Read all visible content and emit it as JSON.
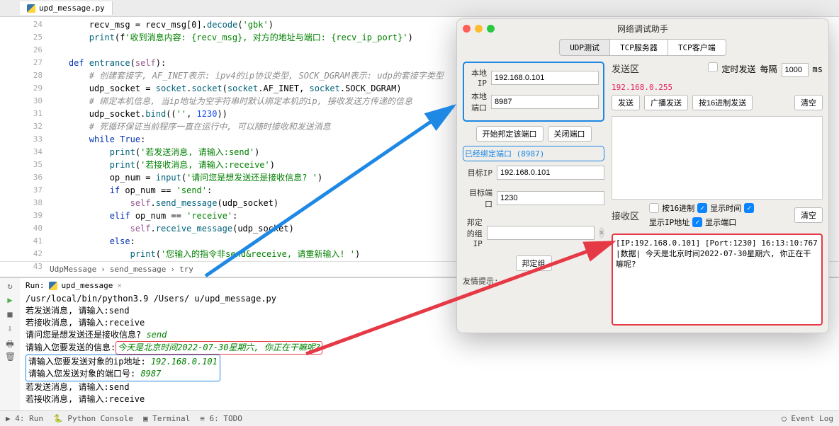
{
  "ide": {
    "file_tab": "upd_message.py",
    "line_start": 24,
    "code_lines": [
      "        recv_msg = recv_msg[0].decode('gbk')",
      "        print(f'收到消息内容: {recv_msg}, 对方的地址与端口: {recv_ip_port}')",
      "",
      "    def entrance(self):",
      "        # 创建套接字, AF_INET表示: ipv4的ip协议类型, SOCK_DGRAM表示: udp的套接字类型",
      "        udp_socket = socket.socket(socket.AF_INET, socket.SOCK_DGRAM)",
      "        # 绑定本机信息, 当ip地址为空字符串时默认绑定本机的ip, 接收发送方传递的信息",
      "        udp_socket.bind(('', 1230))",
      "        # 死循环保证当前程序一直在运行中, 可以随时接收和发送消息",
      "        while True:",
      "            print('若发送消息, 请输入:send')",
      "            print('若接收消息, 请输入:receive')",
      "            op_num = input('请问您是想发送还是接收信息? ')",
      "            if op_num == 'send':",
      "                self.send_message(udp_socket)",
      "            elif op_num == 'receive':",
      "                self.receive_message(udp_socket)",
      "            else:",
      "                print('您输入的指令非send&receive, 请重新输入! ')",
      ""
    ],
    "breadcrumb": [
      "UdpMessage",
      "send_message",
      "try"
    ],
    "run_label": "Run:",
    "run_tab": "upd_message",
    "console_lines": {
      "l0": "/usr/local/bin/python3.9 /Users/                                      u/upd_message.py",
      "l1": "若发送消息, 请输入:send",
      "l2": "若接收消息, 请输入:receive",
      "l3": "请问您是想发送还是接收信息? ",
      "l3v": "send",
      "l4": "请输入您要发送的信息:",
      "l4v": "今天是北京时间2022-07-30星期六, 你正在干嘛呢?",
      "l5": "请输入您要发送对象的ip地址: ",
      "l5v": "192.168.0.101",
      "l6": "请输入您发送对象的端口号: ",
      "l6v": "8987",
      "l7": "若发送消息, 请输入:send",
      "l8": "若接收消息, 请输入:receive"
    },
    "status": {
      "run": "4: Run",
      "console": "Python Console",
      "terminal": "Terminal",
      "todo": "6: TODO",
      "eventlog": "Event Log"
    }
  },
  "net": {
    "title": "网络调试助手",
    "tabs": [
      "UDP测试",
      "TCP服务器",
      "TCP客户端"
    ],
    "local_ip_lbl": "本地IP",
    "local_ip": "192.168.0.101",
    "local_port_lbl": "本地端口",
    "local_port": "8987",
    "btn_bind": "开始邦定该端口",
    "btn_close": "关闭端口",
    "bound_msg": "已经绑定端口 (8987)",
    "target_ip_lbl": "目标IP",
    "target_ip": "192.168.0.101",
    "target_port_lbl": "目标端口",
    "target_port": "1230",
    "group_ip_lbl": "邦定的组IP",
    "btn_group": "邦定组",
    "hint_lbl": "友情提示:",
    "send_title": "发送区",
    "timed_lbl": "定时发送",
    "every_lbl": "每隔",
    "ms_val": "1000",
    "ms_lbl": "ms",
    "target_addr": "192.168.0.255",
    "btn_send": "发送",
    "btn_broadcast": "广播发送",
    "btn_hex_send": "按16进制发送",
    "btn_clear": "清空",
    "recv_title": "接收区",
    "chk_hex": "按16进制",
    "chk_time": "显示时间",
    "chk_ip": "显示IP地址",
    "chk_port": "显示端口",
    "recv_text": "[IP:192.168.0.101] [Port:1230] 16:13:10:767 |数据|   今天是北京时间2022-07-30星期六, 你正在干嘛呢?"
  }
}
